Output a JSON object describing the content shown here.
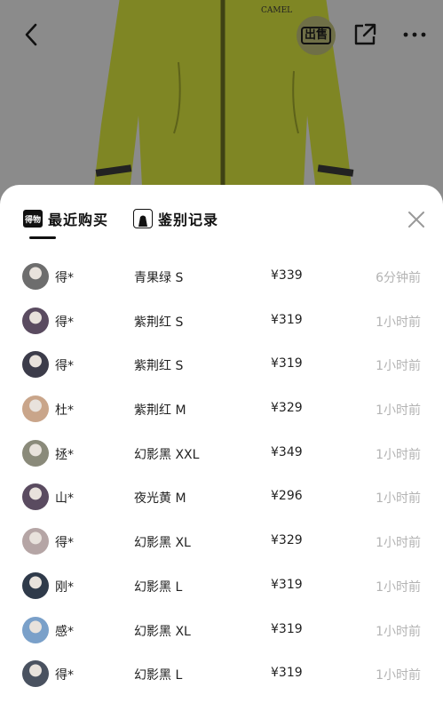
{
  "colors": {
    "jacket": "#7f8624",
    "jacket_dark": "#5d621a",
    "accent": "#111111",
    "muted_text": "#b3b3b3"
  },
  "header": {
    "back_icon": "chevron-left-icon",
    "brand_logo_text": "CAMEL",
    "sell_label": "出售",
    "share_icon": "share-external-icon",
    "more_icon": "more-dots-icon"
  },
  "sheet": {
    "tabs": [
      {
        "icon_text": "得物",
        "label": "最近购买",
        "active": true
      },
      {
        "icon": "bag-icon",
        "label": "鉴别记录",
        "active": false
      }
    ],
    "close_icon": "close-icon",
    "purchases": [
      {
        "buyer": "得*",
        "sku": "青果绿 S",
        "price": "¥339",
        "time": "6分钟前",
        "avatar_color": "#6d6d6d"
      },
      {
        "buyer": "得*",
        "sku": "紫荆红 S",
        "price": "¥319",
        "time": "1小时前",
        "avatar_color": "#5a4b60"
      },
      {
        "buyer": "得*",
        "sku": "紫荆红 S",
        "price": "¥319",
        "time": "1小时前",
        "avatar_color": "#3c3c4a"
      },
      {
        "buyer": "杜*",
        "sku": "紫荆红 M",
        "price": "¥329",
        "time": "1小时前",
        "avatar_color": "#c9a58a"
      },
      {
        "buyer": "拯*",
        "sku": "幻影黑 XXL",
        "price": "¥349",
        "time": "1小时前",
        "avatar_color": "#8a8a7a"
      },
      {
        "buyer": "山*",
        "sku": "夜光黄 M",
        "price": "¥296",
        "time": "1小时前",
        "avatar_color": "#5a4b60"
      },
      {
        "buyer": "得*",
        "sku": "幻影黑 XL",
        "price": "¥329",
        "time": "1小时前",
        "avatar_color": "#b5a5a5"
      },
      {
        "buyer": "刚*",
        "sku": "幻影黑 L",
        "price": "¥319",
        "time": "1小时前",
        "avatar_color": "#2f3a4a"
      },
      {
        "buyer": "感*",
        "sku": "幻影黑 XL",
        "price": "¥319",
        "time": "1小时前",
        "avatar_color": "#7aa0c9"
      },
      {
        "buyer": "得*",
        "sku": "幻影黑 L",
        "price": "¥319",
        "time": "1小时前",
        "avatar_color": "#4a5260"
      }
    ]
  }
}
